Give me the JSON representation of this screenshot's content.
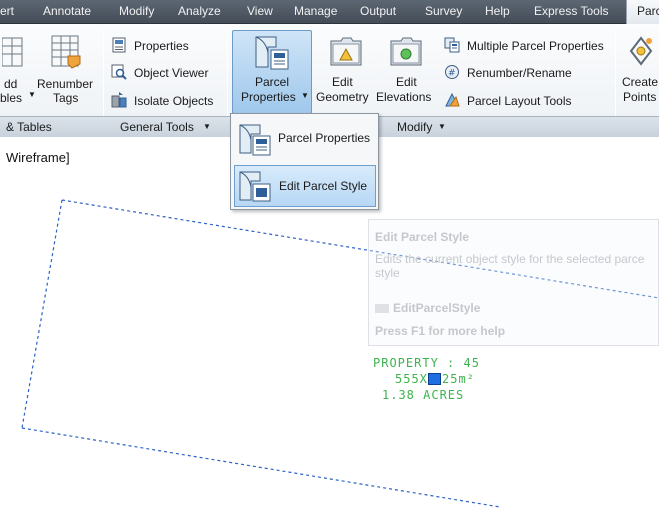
{
  "tabs": [
    {
      "label": "ert",
      "active": false
    },
    {
      "label": "Annotate",
      "active": false
    },
    {
      "label": "Modify",
      "active": false
    },
    {
      "label": "Analyze",
      "active": false
    },
    {
      "label": "View",
      "active": false
    },
    {
      "label": "Manage",
      "active": false
    },
    {
      "label": "Output",
      "active": false
    },
    {
      "label": "Survey",
      "active": false
    },
    {
      "label": "Help",
      "active": false
    },
    {
      "label": "Express Tools",
      "active": false
    },
    {
      "label": "Parc",
      "active": true
    }
  ],
  "ribbon": {
    "add_tables": {
      "line1": "dd",
      "line2": "bles"
    },
    "renumber_tags": {
      "line1": "Renumber",
      "line2": "Tags"
    },
    "panel_tables": "& Tables",
    "general_tools": {
      "properties": "Properties",
      "object_viewer": "Object Viewer",
      "isolate_objects": "Isolate Objects",
      "panel_title": "General Tools"
    },
    "parcel_properties": {
      "line1": "Parcel",
      "line2": "Properties"
    },
    "edit_geometry": {
      "line1": "Edit",
      "line2": "Geometry"
    },
    "edit_elevations": {
      "line1": "Edit",
      "line2": "Elevations"
    },
    "multiple_parcel_properties": "Multiple Parcel Properties",
    "renumber_rename": "Renumber/Rename",
    "parcel_layout_tools": "Parcel Layout Tools",
    "modify_panel_title": "Modify",
    "create_points": {
      "line1": "Create",
      "line2": "Points"
    }
  },
  "dropdown": {
    "items": [
      {
        "label": "Parcel Properties",
        "highlighted": false
      },
      {
        "label": "Edit Parcel Style",
        "highlighted": true
      }
    ]
  },
  "viewport": {
    "label": "Wireframe]"
  },
  "tooltip": {
    "title": "Edit Parcel Style",
    "description_line1": "Edits the current object style for the selected parce",
    "description_line2": "style",
    "command": "EditParcelStyle",
    "help": "Press F1 for more help"
  },
  "parcel_label": {
    "line1": "PROPERTY : 45",
    "line2a": "555X",
    "line2b": "25m²",
    "line3": "1.38 ACRES"
  },
  "colors": {
    "tab_bar": "#4f5864",
    "ribbon_bg": "#f4f6f8",
    "pressed_button": "#b7d7f4",
    "boundary_line": "#2b62c6",
    "parcel_label": "#3fb34f",
    "grip": "#1f6fe0"
  }
}
